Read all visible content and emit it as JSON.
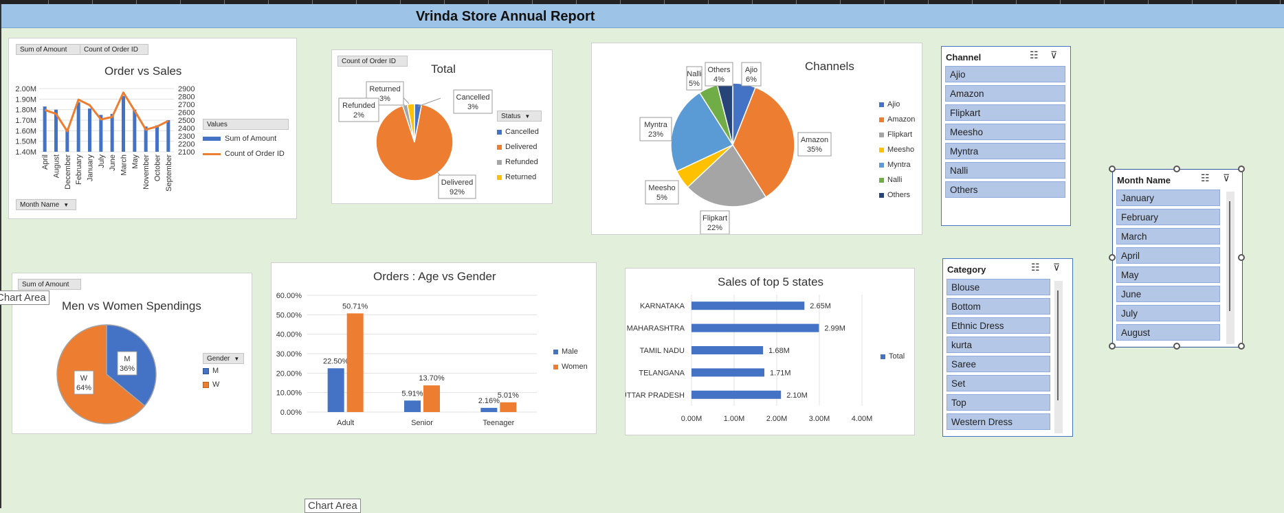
{
  "report_title": "Vrinda Store Annual Report",
  "order_vs_sales": {
    "field_buttons": [
      "Sum of Amount",
      "Count of Order ID"
    ],
    "axis_button": "Month Name",
    "legend_title": "Values",
    "legend_items": [
      "Sum of Amount",
      "Count of Order ID"
    ]
  },
  "total_status": {
    "field_button": "Count of Order ID",
    "legend_title": "Status",
    "legend_items": [
      "Cancelled",
      "Delivered",
      "Refunded",
      "Returned"
    ],
    "callouts": [
      {
        "name": "Cancelled",
        "pct": "3%"
      },
      {
        "name": "Returned",
        "pct": "3%"
      },
      {
        "name": "Refunded",
        "pct": "2%"
      },
      {
        "name": "Delivered",
        "pct": "92%"
      }
    ]
  },
  "channels": {
    "legend_items": [
      "Ajio",
      "Amazon",
      "Flipkart",
      "Meesho",
      "Myntra",
      "Nalli",
      "Others"
    ],
    "callouts": [
      {
        "name": "Ajio",
        "pct": "6%"
      },
      {
        "name": "Amazon",
        "pct": "35%"
      },
      {
        "name": "Flipkart",
        "pct": "22%"
      },
      {
        "name": "Meesho",
        "pct": "5%"
      },
      {
        "name": "Myntra",
        "pct": "23%"
      },
      {
        "name": "Nalli",
        "pct": "5%"
      },
      {
        "name": "Others",
        "pct": "4%"
      }
    ]
  },
  "gender_spend": {
    "field_button": "Sum of Amount",
    "legend_title": "Gender",
    "legend_items": [
      "M",
      "W"
    ],
    "callouts": [
      {
        "name": "M",
        "pct": "36%"
      },
      {
        "name": "W",
        "pct": "64%"
      }
    ]
  },
  "age_gender": {
    "legend_items": [
      "Male",
      "Women"
    ]
  },
  "top_states": {
    "legend_items": [
      "Total"
    ]
  },
  "slicers": {
    "channel": {
      "title": "Channel",
      "items": [
        "Ajio",
        "Amazon",
        "Flipkart",
        "Meesho",
        "Myntra",
        "Nalli",
        "Others"
      ]
    },
    "category": {
      "title": "Category",
      "items": [
        "Blouse",
        "Bottom",
        "Ethnic Dress",
        "kurta",
        "Saree",
        "Set",
        "Top",
        "Western Dress"
      ]
    },
    "month": {
      "title": "Month Name",
      "items": [
        "January",
        "February",
        "March",
        "April",
        "May",
        "June",
        "July",
        "August"
      ]
    }
  },
  "tooltips": {
    "chart_area_left": "Chart Area",
    "chart_area_bottom": "Chart Area"
  },
  "colors": {
    "blue": "#4472c4",
    "orange": "#ed7d31",
    "gray": "#a5a5a5",
    "yellow": "#ffc000",
    "lightblue": "#5b9bd5",
    "green": "#70ad47",
    "navy": "#264478",
    "title_bar": "#9dc3e6",
    "background": "#e2efda"
  },
  "chart_data": [
    {
      "type": "bar",
      "title": "Order vs Sales",
      "categories": [
        "April",
        "August",
        "December",
        "February",
        "January",
        "July",
        "June",
        "March",
        "May",
        "November",
        "October",
        "September"
      ],
      "series": [
        {
          "name": "Sum of Amount",
          "values": [
            1.83,
            1.8,
            1.62,
            1.87,
            1.81,
            1.75,
            1.76,
            1.93,
            1.8,
            1.64,
            1.65,
            1.7
          ]
        },
        {
          "name": "Count of Order ID",
          "values": [
            2630,
            2580,
            2360,
            2760,
            2690,
            2510,
            2540,
            2850,
            2620,
            2380,
            2420,
            2490
          ]
        }
      ],
      "y_ticks": [
        "2.00M",
        "1.90M",
        "1.80M",
        "1.70M",
        "1.60M",
        "1.50M",
        "1.40M"
      ],
      "y2_ticks": [
        "2900",
        "2800",
        "2700",
        "2600",
        "2500",
        "2400",
        "2300",
        "2200",
        "2100"
      ],
      "ylim": [
        1.4,
        2.0
      ],
      "y2lim": [
        2100,
        2900
      ]
    },
    {
      "type": "pie",
      "title": "Total",
      "categories": [
        "Cancelled",
        "Delivered",
        "Refunded",
        "Returned"
      ],
      "values": [
        3,
        92,
        2,
        3
      ]
    },
    {
      "type": "pie",
      "title": "Channels",
      "categories": [
        "Ajio",
        "Amazon",
        "Flipkart",
        "Meesho",
        "Myntra",
        "Nalli",
        "Others"
      ],
      "values": [
        6,
        35,
        22,
        5,
        23,
        5,
        4
      ]
    },
    {
      "type": "pie",
      "title": "Men vs Women Spendings",
      "categories": [
        "M",
        "W"
      ],
      "values": [
        36,
        64
      ]
    },
    {
      "type": "bar",
      "title": "Orders : Age vs Gender",
      "categories": [
        "Adult",
        "Senior",
        "Teenager"
      ],
      "series": [
        {
          "name": "Male",
          "values": [
            22.5,
            5.91,
            2.16
          ],
          "labels": [
            "22.50%",
            "5.91%",
            "2.16%"
          ]
        },
        {
          "name": "Women",
          "values": [
            50.71,
            13.7,
            5.01
          ],
          "labels": [
            "50.71%",
            "13.70%",
            "5.01%"
          ]
        }
      ],
      "y_ticks": [
        "60.00%",
        "50.00%",
        "40.00%",
        "30.00%",
        "20.00%",
        "10.00%",
        "0.00%"
      ],
      "ylim": [
        0,
        60
      ]
    },
    {
      "type": "bar",
      "orientation": "horizontal",
      "title": "Sales of top 5 states",
      "categories": [
        "KARNATAKA",
        "MAHARASHTRA",
        "TAMIL NADU",
        "TELANGANA",
        "UTTAR PRADESH"
      ],
      "series": [
        {
          "name": "Total",
          "values": [
            2.65,
            2.99,
            1.68,
            1.71,
            2.1
          ],
          "labels": [
            "2.65M",
            "2.99M",
            "1.68M",
            "1.71M",
            "2.10M"
          ]
        }
      ],
      "x_ticks": [
        "0.00M",
        "1.00M",
        "2.00M",
        "3.00M",
        "4.00M"
      ],
      "xlim": [
        0,
        4
      ]
    }
  ]
}
